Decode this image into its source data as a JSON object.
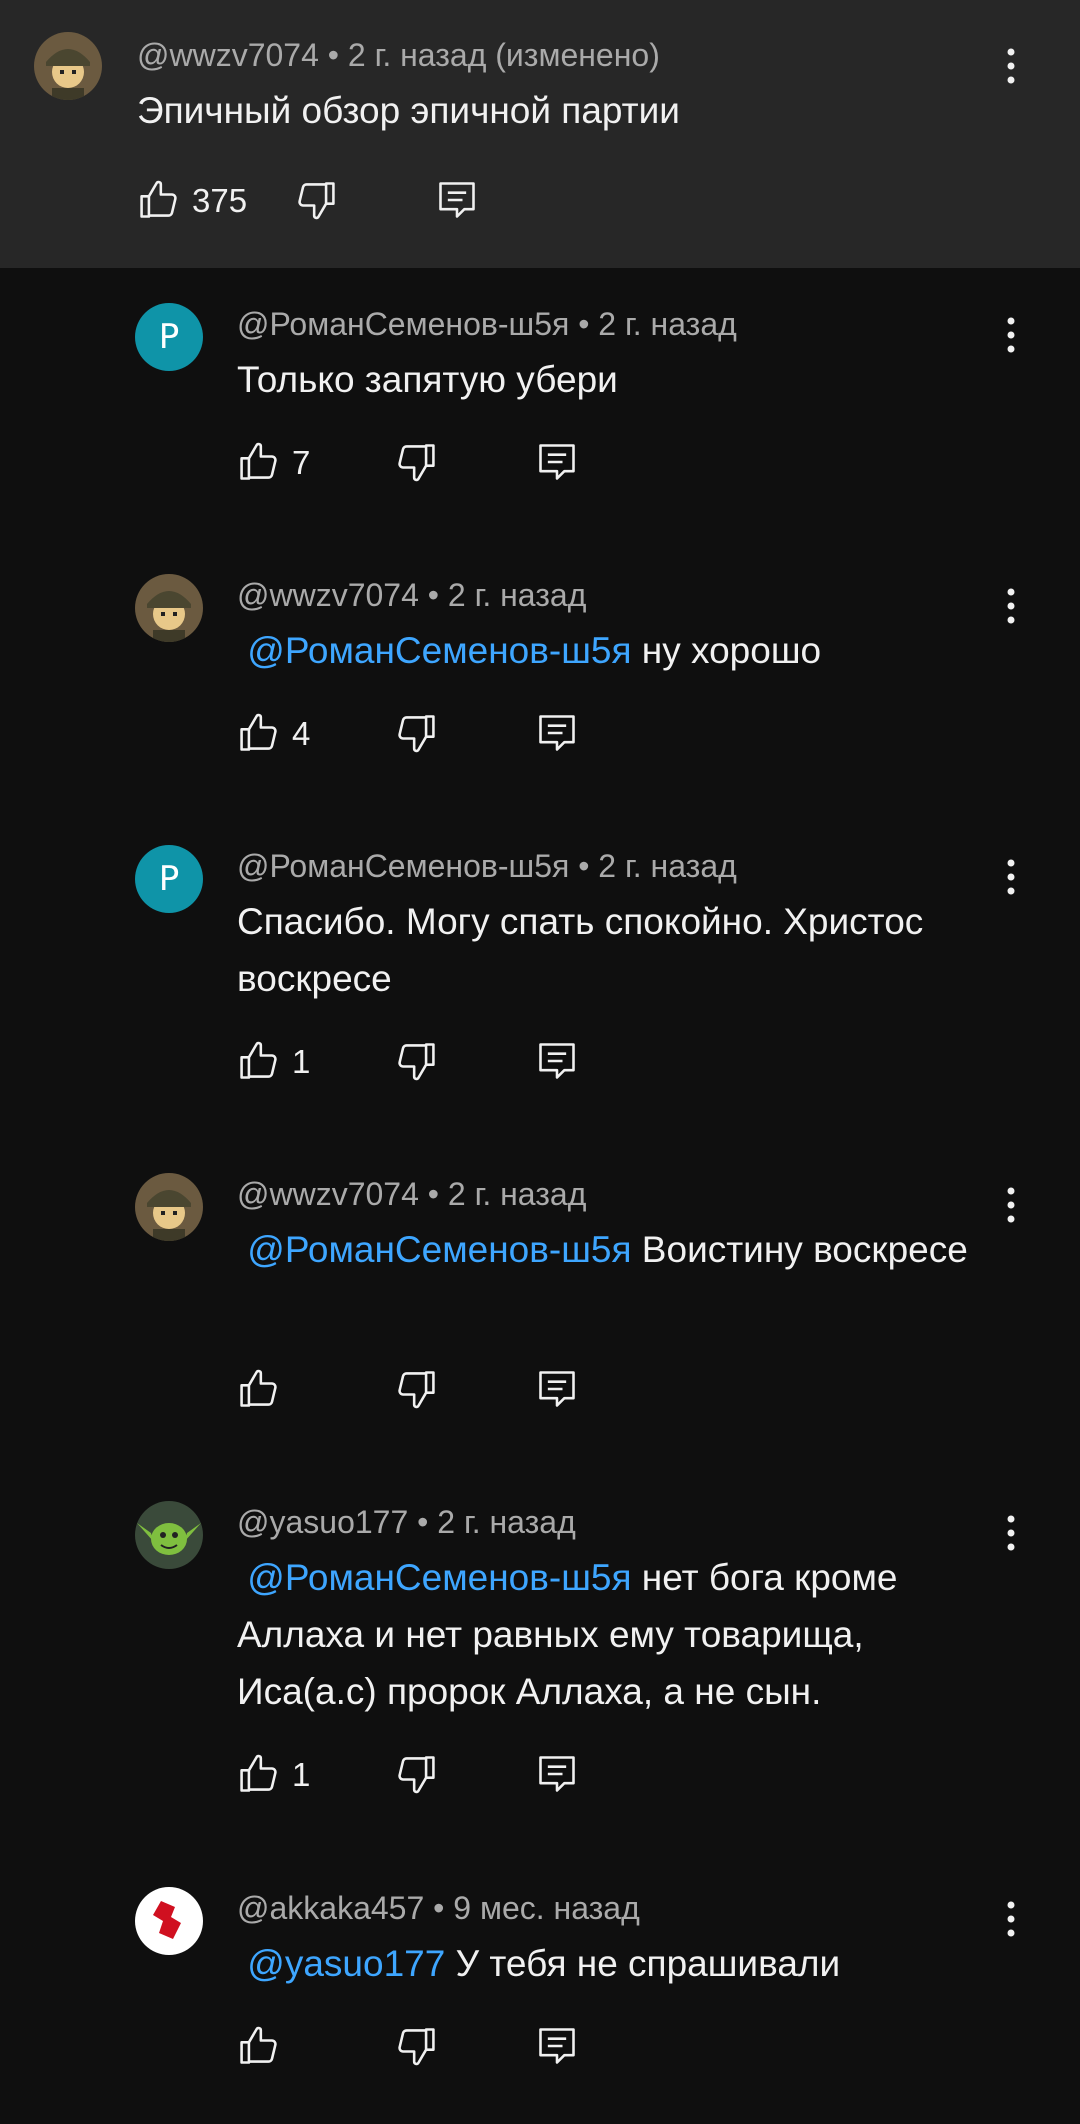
{
  "main_comment": {
    "author": "@wwzv7074",
    "sep": "•",
    "time": "2 г. назад (изменено)",
    "text": "Эпичный обзор эпичной партии",
    "likes": "375"
  },
  "replies": [
    {
      "author": "@РоманСеменов-ш5я",
      "time": "2 г. назад",
      "avatar_letter": "Р",
      "mention": "",
      "text": "Только запятую убери",
      "likes": "7"
    },
    {
      "author": "@wwzv7074",
      "time": "2 г. назад",
      "avatar_letter": "",
      "mention": "@РоманСеменов-ш5я",
      "text": " ну хорошо",
      "likes": "4"
    },
    {
      "author": "@РоманСеменов-ш5я",
      "time": "2 г. назад",
      "avatar_letter": "Р",
      "mention": "",
      "text": "Спасибо. Могу спать спокойно. Христос воскресе",
      "likes": "1"
    },
    {
      "author": "@wwzv7074",
      "time": "2 г. назад",
      "avatar_letter": "",
      "mention": "@РоманСеменов-ш5я",
      "text": "  Воистину воскресе",
      "likes": ""
    },
    {
      "author": "@yasuo177",
      "time": "2 г. назад",
      "avatar_letter": "",
      "mention": "@РоманСеменов-ш5я",
      "text": "  нет бога кроме Аллаха и нет равных ему товарища, Иса(а.с) пророк Аллаха, а не сын.",
      "likes": "1"
    },
    {
      "author": "@akkaka457",
      "time": "9 мес. назад",
      "avatar_letter": "",
      "mention": "@yasuo177",
      "text": " У тебя не спрашивали",
      "likes": ""
    }
  ],
  "colors": {
    "background": "#0f0f0f",
    "main_bg": "#272727",
    "mention": "#3ea6ff",
    "avatar_letter_bg": "#0f94a8"
  }
}
